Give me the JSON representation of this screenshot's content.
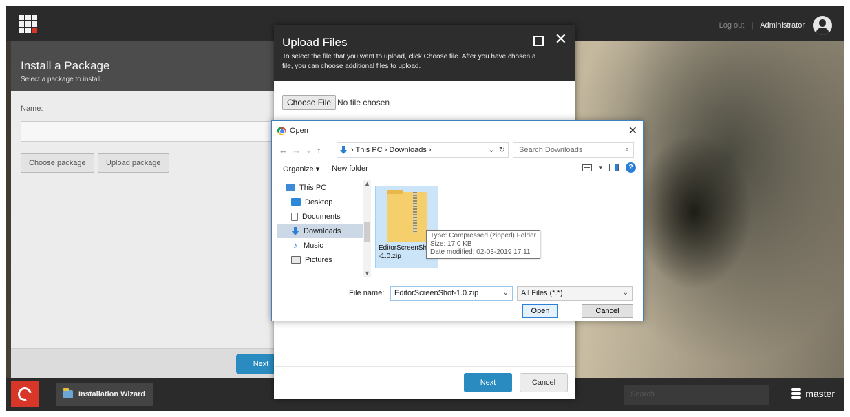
{
  "topbar": {
    "logout": "Log out",
    "separator": "|",
    "user": "Administrator"
  },
  "install": {
    "title": "Install a Package",
    "subtitle": "Select a package to install.",
    "name_label": "Name:",
    "name_value": "",
    "choose_package": "Choose package",
    "upload_package": "Upload package",
    "next": "Next"
  },
  "taskbar": {
    "wizard": "Installation Wizard",
    "search_placeholder": "Search",
    "database": "master"
  },
  "upload": {
    "title": "Upload Files",
    "description": "To select the file that you want to upload, click Choose file. After you have chosen a file, you can choose additional files to upload.",
    "choose_file": "Choose File",
    "no_file": "No file chosen",
    "next": "Next",
    "cancel": "Cancel"
  },
  "open_dialog": {
    "title": "Open",
    "breadcrumb": "›  This PC  ›  Downloads  ›",
    "search_placeholder": "Search Downloads",
    "organize": "Organize ▾",
    "new_folder": "New folder",
    "tree": [
      {
        "label": "This PC"
      },
      {
        "label": "Desktop"
      },
      {
        "label": "Documents"
      },
      {
        "label": "Downloads"
      },
      {
        "label": "Music"
      },
      {
        "label": "Pictures"
      }
    ],
    "file": {
      "name_line1": "EditorScreenShot",
      "name_line2": "-1.0.zip"
    },
    "tooltip": {
      "type": "Type: Compressed (zipped) Folder",
      "size": "Size: 17.0 KB",
      "modified": "Date modified: 02-03-2019 17:11"
    },
    "filename_label": "File name:",
    "filename_value": "EditorScreenShot-1.0.zip",
    "filetype": "All Files (*.*)",
    "open_btn": "Open",
    "cancel_btn": "Cancel"
  },
  "colors": {
    "accent": "#2a8bc1",
    "brand_red": "#d9362a",
    "topbar": "#2b2b2b",
    "selection": "#cce4f7"
  }
}
